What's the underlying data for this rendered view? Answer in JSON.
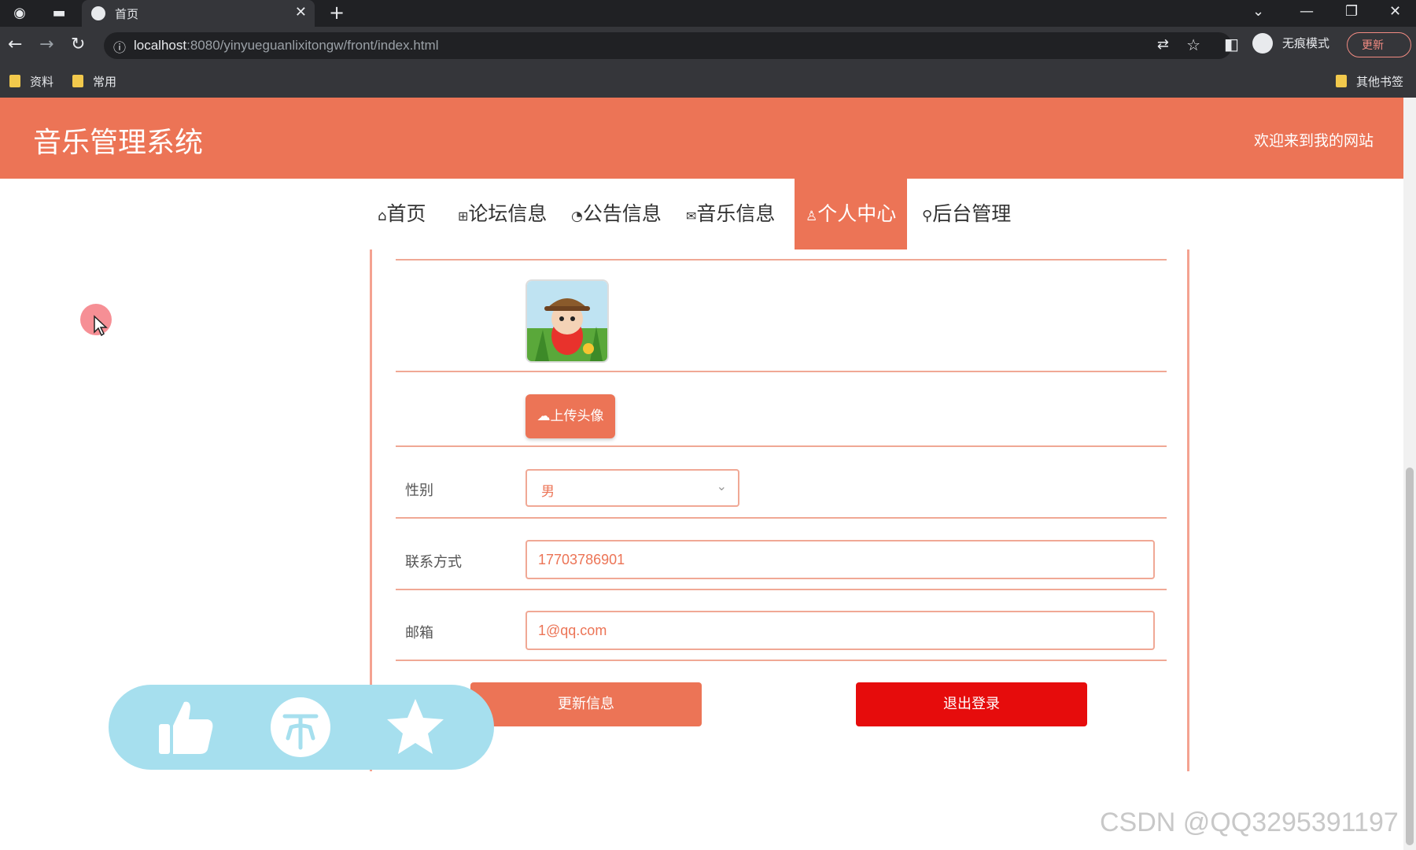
{
  "browser": {
    "tab_title": "首页",
    "url_host": "localhost",
    "url_path": ":8080/yinyueguanlixitongw/front/index.html",
    "profile_label": "无痕模式",
    "update_label": "更新",
    "bookmarks": [
      "资料",
      "常用"
    ],
    "other_bookmarks": "其他书签"
  },
  "header": {
    "site_title": "音乐管理系统",
    "welcome": "欢迎来到我的网站"
  },
  "nav": {
    "items": [
      {
        "label": "首页",
        "icon": "home-icon"
      },
      {
        "label": "论坛信息",
        "icon": "forum-icon"
      },
      {
        "label": "公告信息",
        "icon": "notice-icon"
      },
      {
        "label": "音乐信息",
        "icon": "mail-icon"
      },
      {
        "label": "个人中心",
        "icon": "user-icon",
        "active": true
      },
      {
        "label": "后台管理",
        "icon": "link-icon"
      }
    ]
  },
  "form": {
    "upload_label": "上传头像",
    "gender_label": "性别",
    "gender_value": "男",
    "phone_label": "联系方式",
    "phone_value": "17703786901",
    "email_label": "邮箱",
    "email_value": "1@qq.com",
    "update_button": "更新信息",
    "logout_button": "退出登录"
  },
  "watermark": "CSDN @QQ3295391197",
  "colors": {
    "accent": "#ec7456",
    "danger": "#e60c0c",
    "overlay": "#a6dfee"
  }
}
